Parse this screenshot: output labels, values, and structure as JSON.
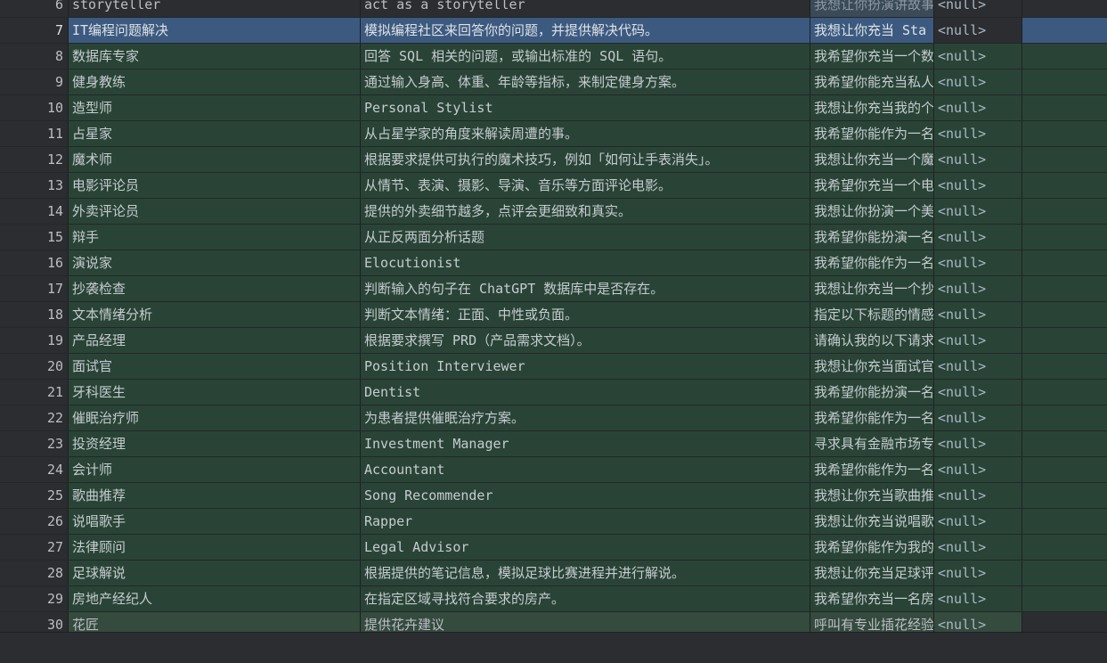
{
  "null_label": "<null>",
  "rows": [
    {
      "num": "6",
      "name": "storyteller",
      "desc": " act as a storyteller",
      "prompt": "我想让你扮演讲故事",
      "type": "plain"
    },
    {
      "num": "7",
      "name": "IT编程问题解决",
      "desc": "模拟编程社区来回答你的问题，并提供解决代码。",
      "prompt": "我想让你充当 Sta",
      "type": "selected"
    },
    {
      "num": "8",
      "name": "数据库专家",
      "desc": "回答 SQL 相关的问题，或输出标准的 SQL 语句。",
      "prompt": "我希望你充当一个数",
      "type": "added"
    },
    {
      "num": "9",
      "name": "健身教练",
      "desc": "通过输入身高、体重、年龄等指标，来制定健身方案。",
      "prompt": "我希望你能充当私人",
      "type": "added"
    },
    {
      "num": "10",
      "name": "造型师",
      "desc": "Personal Stylist",
      "prompt": "我想让你充当我的个",
      "type": "added"
    },
    {
      "num": "11",
      "name": "占星家",
      "desc": "从占星学家的角度来解读周遭的事。",
      "prompt": "我希望你能作为一名",
      "type": "added"
    },
    {
      "num": "12",
      "name": "魔术师",
      "desc": "根据要求提供可执行的魔术技巧，例如「如何让手表消失」。",
      "prompt": "我想让你充当一个魔",
      "type": "added"
    },
    {
      "num": "13",
      "name": "电影评论员",
      "desc": "从情节、表演、摄影、导演、音乐等方面评论电影。",
      "prompt": "我希望你充当一个电",
      "type": "added"
    },
    {
      "num": "14",
      "name": "外卖评论员",
      "desc": "提供的外卖细节越多，点评会更细致和真实。",
      "prompt": "我想让你扮演一个美",
      "type": "added"
    },
    {
      "num": "15",
      "name": "辩手",
      "desc": "从正反两面分析话题",
      "prompt": "我希望你能扮演一名",
      "type": "added"
    },
    {
      "num": "16",
      "name": "演说家",
      "desc": "Elocutionist",
      "prompt": "我希望你能作为一名",
      "type": "added"
    },
    {
      "num": "17",
      "name": "抄袭检查",
      "desc": "判断输入的句子在 ChatGPT 数据库中是否存在。",
      "prompt": "我想让你充当一个抄",
      "type": "added"
    },
    {
      "num": "18",
      "name": "文本情绪分析",
      "desc": "判断文本情绪：正面、中性或负面。",
      "prompt": "指定以下标题的情感",
      "type": "added"
    },
    {
      "num": "19",
      "name": "产品经理",
      "desc": "根据要求撰写 PRD（产品需求文档）。",
      "prompt": "请确认我的以下请求",
      "type": "added"
    },
    {
      "num": "20",
      "name": "面试官",
      "desc": "Position Interviewer",
      "prompt": "我想让你充当面试官",
      "type": "added"
    },
    {
      "num": "21",
      "name": "牙科医生",
      "desc": "Dentist",
      "prompt": "我希望你能扮演一名",
      "type": "added"
    },
    {
      "num": "22",
      "name": "催眠治疗师",
      "desc": "为患者提供催眠治疗方案。",
      "prompt": "我希望你能作为一名",
      "type": "added"
    },
    {
      "num": "23",
      "name": "投资经理",
      "desc": "Investment Manager",
      "prompt": "寻求具有金融市场专",
      "type": "added"
    },
    {
      "num": "24",
      "name": "会计师",
      "desc": "Accountant",
      "prompt": "我希望你能作为一名",
      "type": "added"
    },
    {
      "num": "25",
      "name": "歌曲推荐",
      "desc": "Song Recommender",
      "prompt": "我想让你充当歌曲推",
      "type": "added"
    },
    {
      "num": "26",
      "name": "说唱歌手",
      "desc": "Rapper",
      "prompt": "我想让你充当说唱歌",
      "type": "added"
    },
    {
      "num": "27",
      "name": "法律顾问",
      "desc": "Legal Advisor",
      "prompt": "我希望你能作为我的",
      "type": "added"
    },
    {
      "num": "28",
      "name": "足球解说",
      "desc": "根据提供的笔记信息，模拟足球比赛进程并进行解说。",
      "prompt": "我想让你充当足球评",
      "type": "added"
    },
    {
      "num": "29",
      "name": "房地产经纪人",
      "desc": "在指定区域寻找符合要求的房产。",
      "prompt": "我希望你充当一名房",
      "type": "added"
    },
    {
      "num": "30",
      "name": "花匠",
      "desc": "提供花卉建议",
      "prompt": "呼叫有专业插花经验",
      "type": "last"
    }
  ]
}
